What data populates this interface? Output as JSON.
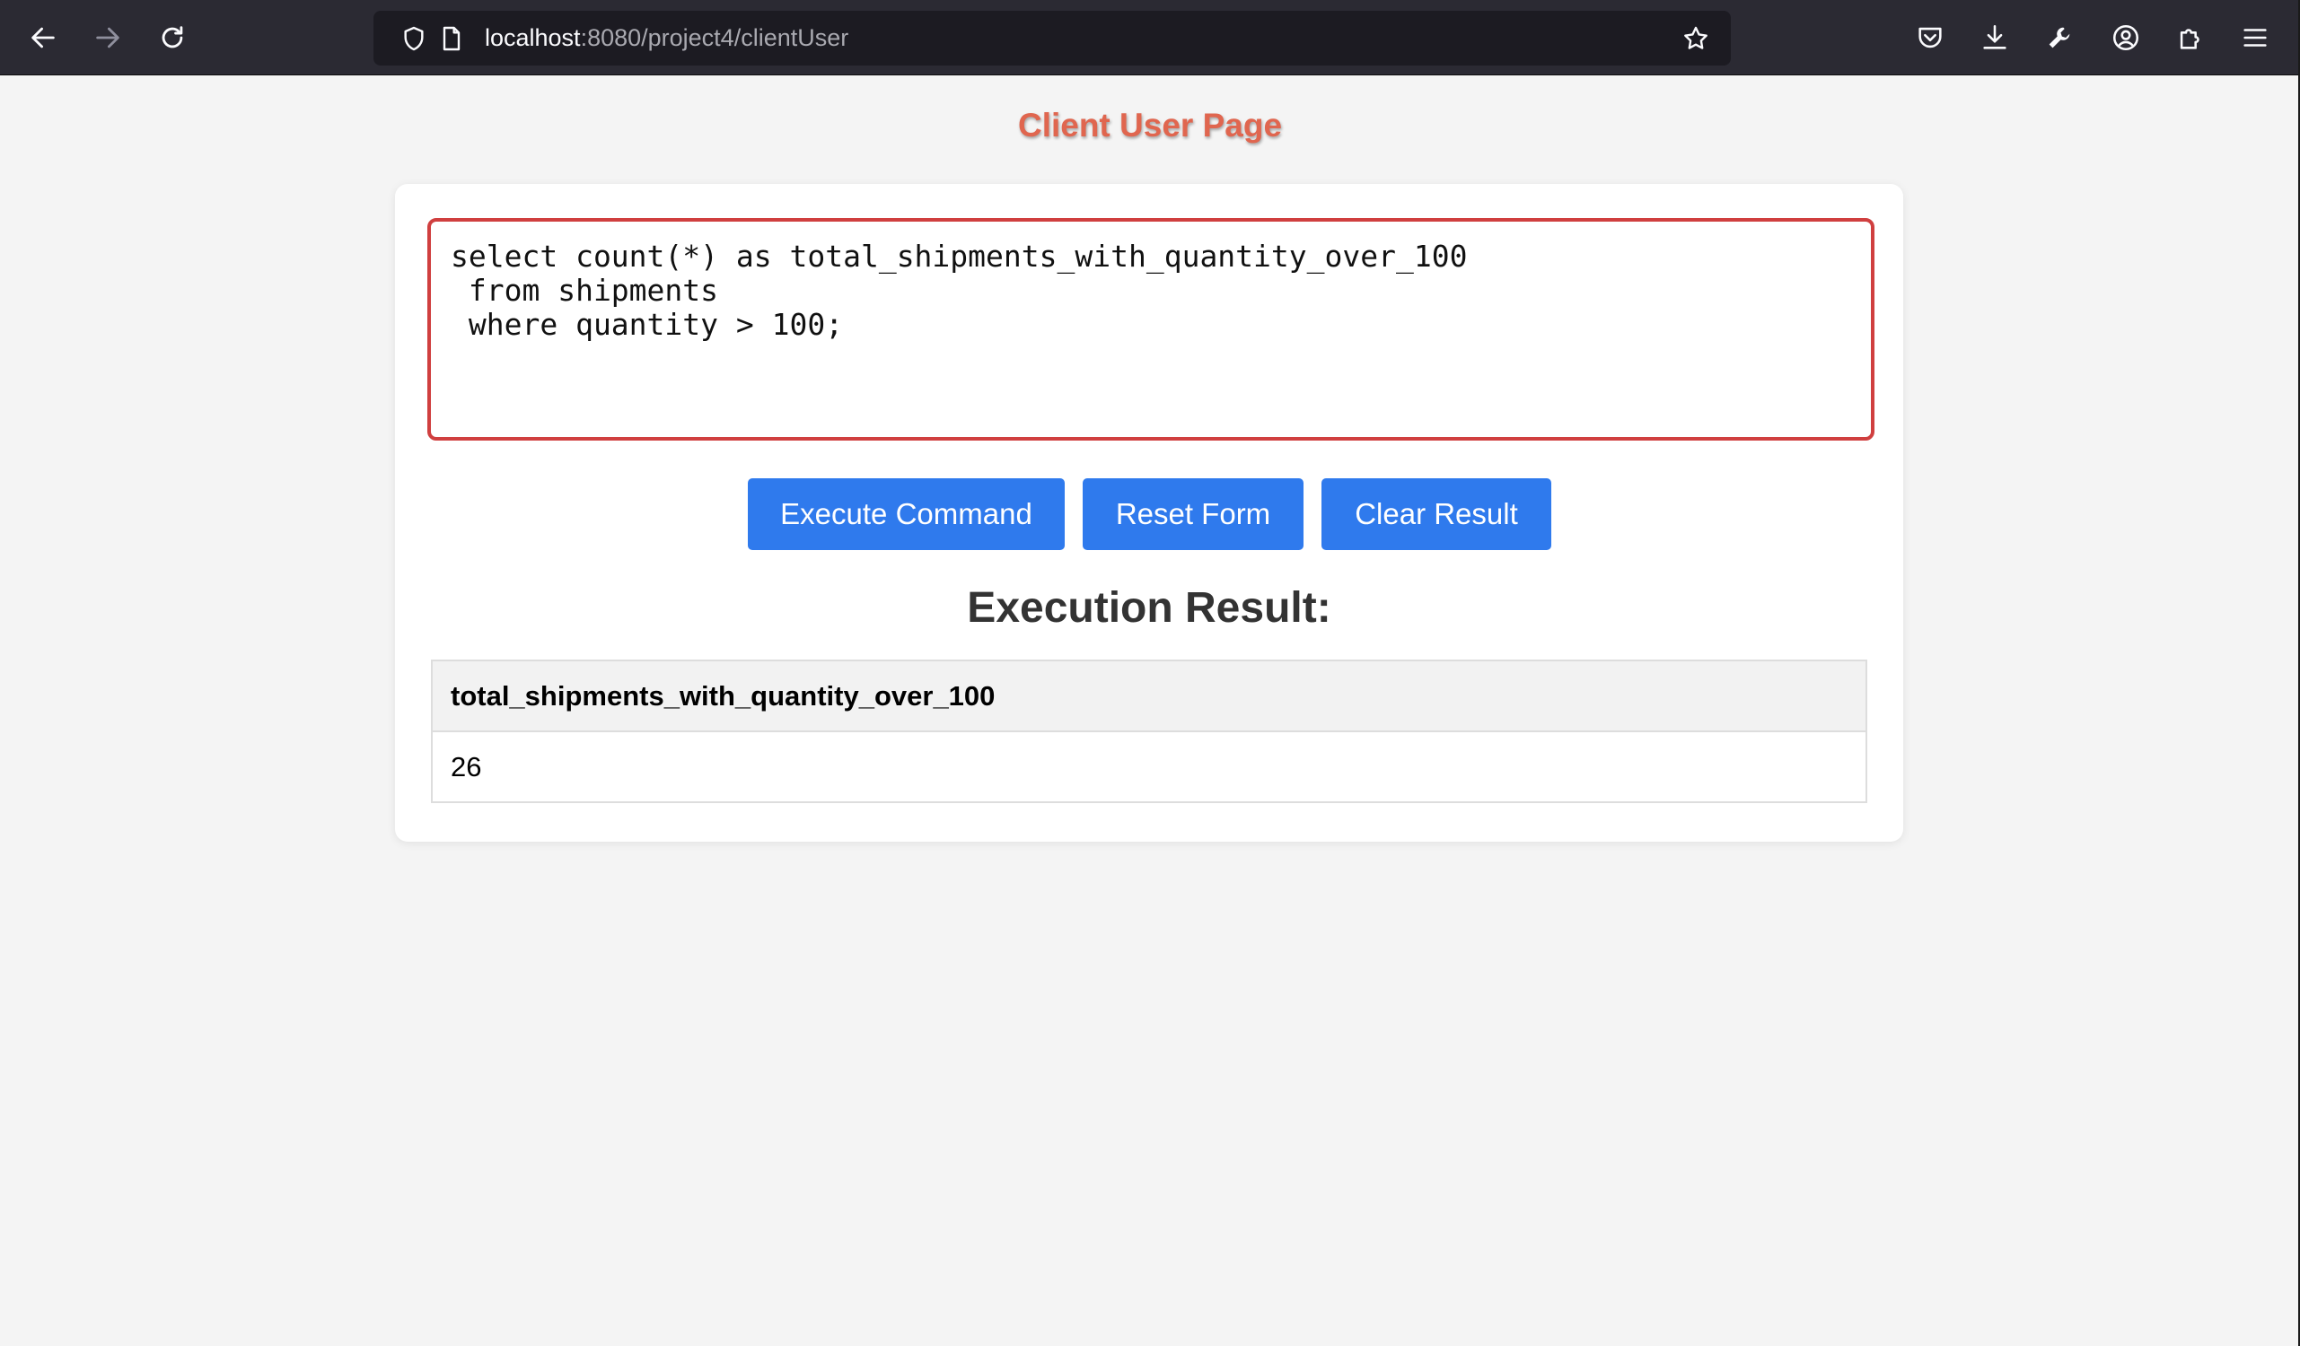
{
  "browser": {
    "url_host": "localhost",
    "url_rest": ":8080/project4/clientUser"
  },
  "page": {
    "title": "Client User Page",
    "query_text": "select count(*) as total_shipments_with_quantity_over_100\n from shipments\n where quantity > 100;",
    "buttons": {
      "execute": "Execute Command",
      "reset": "Reset Form",
      "clear": "Clear Result"
    },
    "result_heading": "Execution Result:",
    "result_table": {
      "columns": [
        "total_shipments_with_quantity_over_100"
      ],
      "rows": [
        [
          "26"
        ]
      ]
    }
  },
  "colors": {
    "title": "#e0664f",
    "button": "#2f7aed",
    "query_border": "#d03f3f"
  }
}
